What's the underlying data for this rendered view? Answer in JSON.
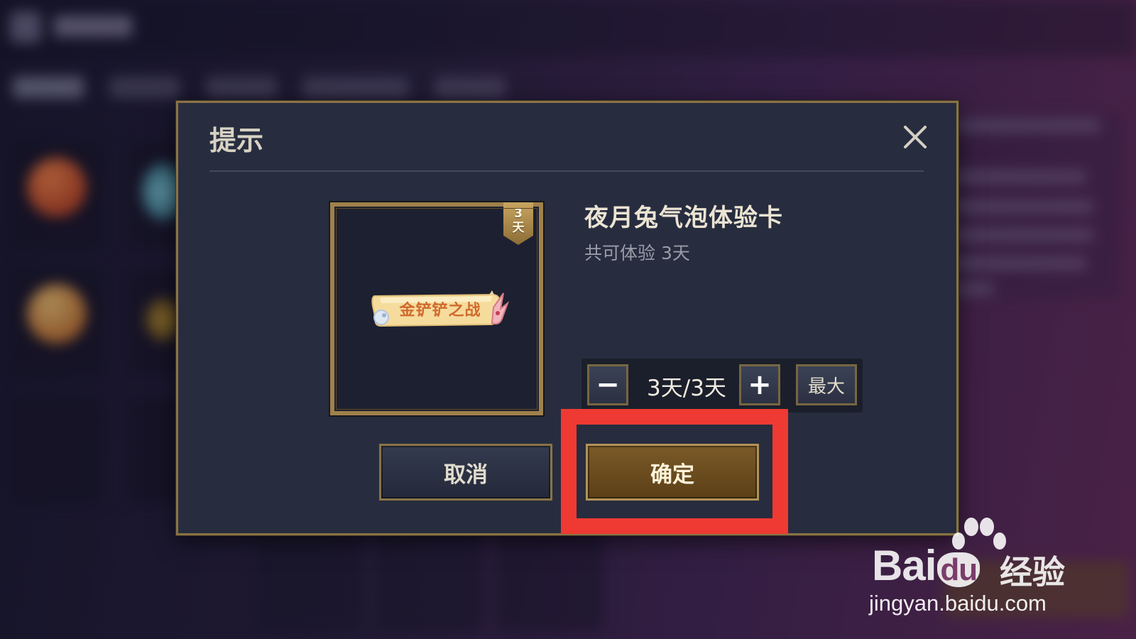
{
  "dialog": {
    "title": "提示",
    "close_icon": "close-icon"
  },
  "item": {
    "name": "夜月兔气泡体验卡",
    "description": "共可体验 3天",
    "banner_text": "金铲铲之战",
    "day_tag": {
      "number": "3",
      "unit": "天"
    }
  },
  "stepper": {
    "minus_icon": "minus-icon",
    "plus_icon": "plus-icon",
    "minus_symbol": "−",
    "plus_symbol": "+",
    "value": "3天/3天",
    "max_label": "最大"
  },
  "actions": {
    "cancel_label": "取消",
    "confirm_label": "确定"
  },
  "annotation": {
    "highlight_color": "#ee3a32",
    "target": "confirm-button"
  },
  "watermark": {
    "brand_left": "Bai",
    "brand_right": "du",
    "brand_suffix": "经验",
    "url": "jingyan.baidu.com"
  },
  "colors": {
    "dialog_bg": "#272d3f",
    "gold_border": "#8a7346",
    "confirm_bg": "#6b4c1f"
  }
}
